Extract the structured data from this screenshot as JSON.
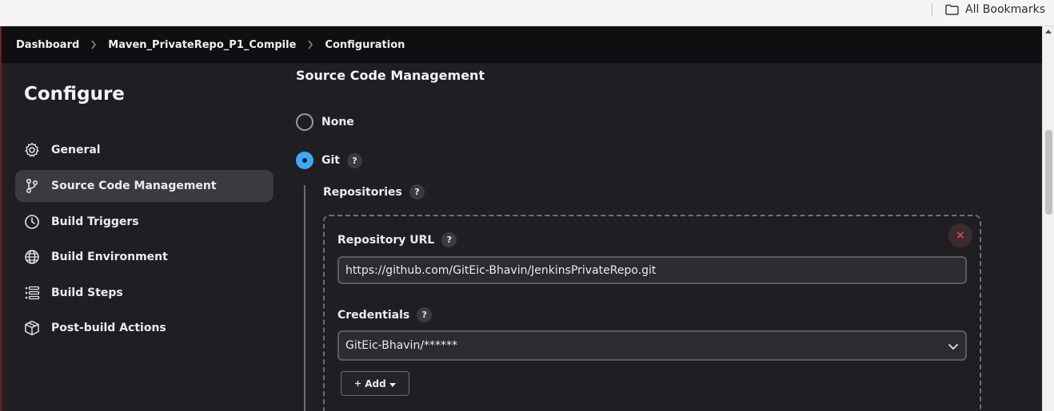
{
  "browser": {
    "bookmarks_label": "All Bookmarks"
  },
  "breadcrumb": [
    "Dashboard",
    "Maven_PrivateRepo_P1_Compile",
    "Configuration"
  ],
  "sidebar": {
    "title": "Configure",
    "items": [
      {
        "label": "General",
        "icon": "gear-icon",
        "active": false
      },
      {
        "label": "Source Code Management",
        "icon": "branch-icon",
        "active": true
      },
      {
        "label": "Build Triggers",
        "icon": "clock-icon",
        "active": false
      },
      {
        "label": "Build Environment",
        "icon": "globe-icon",
        "active": false
      },
      {
        "label": "Build Steps",
        "icon": "list-icon",
        "active": false
      },
      {
        "label": "Post-build Actions",
        "icon": "box-icon",
        "active": false
      }
    ]
  },
  "scm": {
    "title": "Source Code Management",
    "options": [
      {
        "label": "None",
        "checked": false
      },
      {
        "label": "Git",
        "checked": true
      }
    ],
    "help_glyph": "?",
    "repositories_label": "Repositories",
    "repository_url_label": "Repository URL",
    "repository_url_value": "https://github.com/GitEic-Bhavin/JenkinsPrivateRepo.git",
    "credentials_label": "Credentials",
    "credentials_value": "GitEic-Bhavin/******",
    "add_label": "Add",
    "delete_glyph": "×"
  },
  "colors": {
    "accent": "#3fa9f5",
    "danger": "#e5484d",
    "background": "#1f1f23"
  }
}
